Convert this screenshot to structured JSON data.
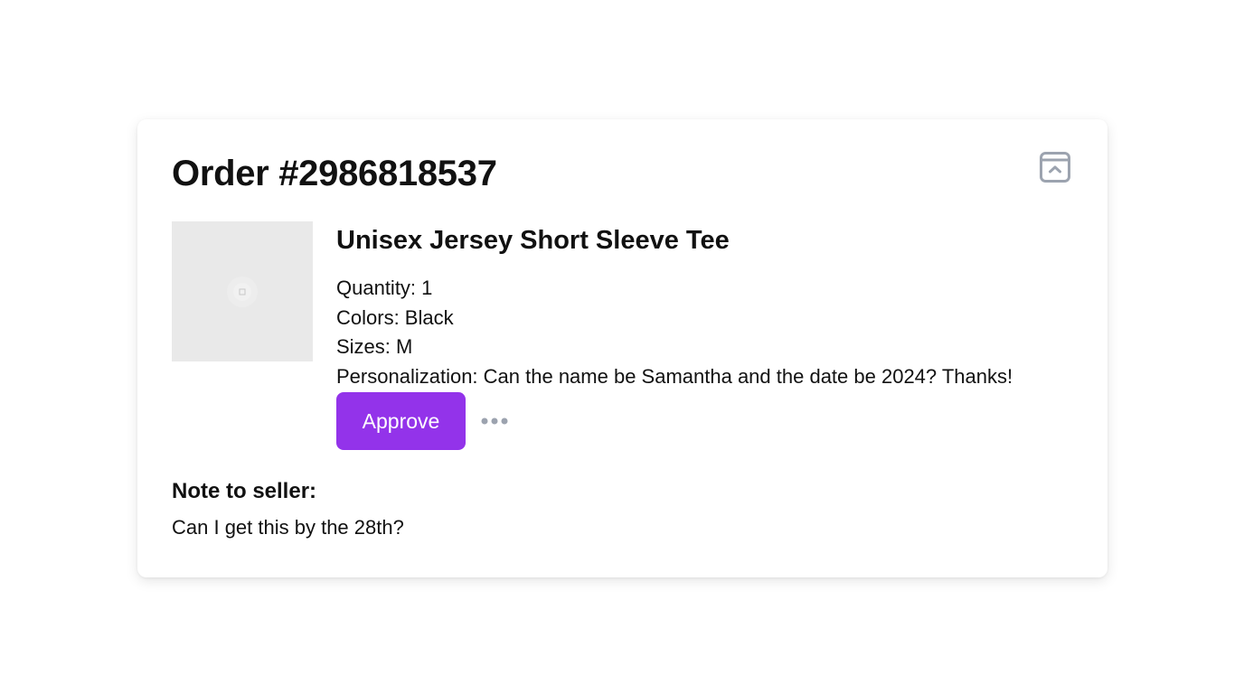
{
  "order": {
    "title": "Order #2986818537"
  },
  "collapse": {
    "icon": "collapse-up-icon"
  },
  "item": {
    "thumbnail_icon": "image-placeholder-icon",
    "name": "Unisex Jersey Short Sleeve Tee",
    "attributes": [
      "Quantity: 1",
      "Colors: Black",
      "Sizes: M",
      "Personalization: Can the name be Samantha and the date be 2024? Thanks!"
    ],
    "approve_label": "Approve",
    "more_icon": "more-horizontal-icon"
  },
  "note": {
    "label": "Note to seller:",
    "text": "Can I get this by the 28th?"
  },
  "colors": {
    "accent": "#9333ea",
    "icon_gray": "#9ca3af",
    "thumb_bg": "#e9e9e9"
  }
}
